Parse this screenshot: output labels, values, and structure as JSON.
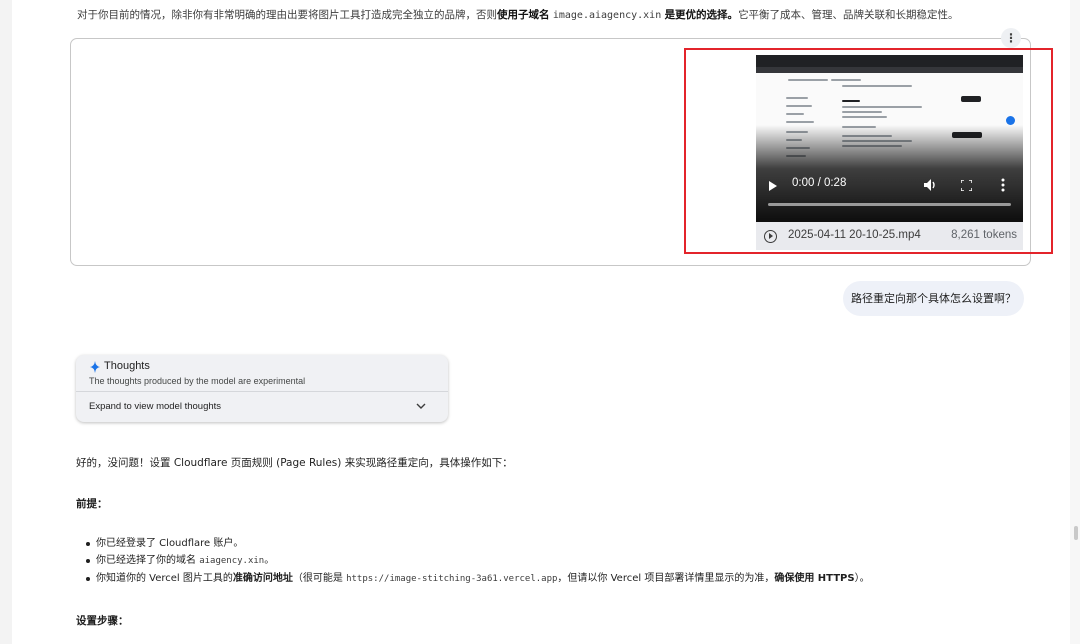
{
  "top_paragraph": {
    "prefix": "对于你目前的情况，除非你有非常明确的理由出要将图片工具打造成完全独立的品牌，否则",
    "bold_a": "使用子域名",
    "domain": "image.aiagency.xin",
    "bold_b": "是更优的选择。",
    "suffix": "它平衡了成本、管理、品牌关联和长期稳定性。"
  },
  "more_button": "⋮",
  "attachment": {
    "video_time": "0:00 / 0:28",
    "progress_fraction": 0.0,
    "file_name": "2025-04-11 20-10-25.mp4",
    "tokens": "8,261 tokens"
  },
  "user_message": "路径重定向那个具体怎么设置啊？",
  "thoughts": {
    "title": "Thoughts",
    "subtitle": "The thoughts produced by the model are experimental",
    "expand_label": "Expand to view model thoughts"
  },
  "response": {
    "intro": "好的，没问题！设置 Cloudflare 页面规则 (Page Rules) 来实现路径重定向，具体操作如下：",
    "prereq_heading": "前提：",
    "bullets": {
      "b1": "你已经登录了 Cloudflare 账户。",
      "b2_prefix": "你已经选择了你的域名 ",
      "b2_code": "aiagency.xin",
      "b2_suffix": "。",
      "b3_prefix": "你知道你的 Vercel 图片工具的",
      "b3_bold": "准确访问地址",
      "b3_mid": "（很可能是 ",
      "b3_code": "https://image-stitching-3a61.vercel.app",
      "b3_mid2": "，但请以你 Vercel 项目部署详情里显示的为准，",
      "b3_bold2": "确保使用 HTTPS",
      "b3_end": "）。"
    },
    "steps_heading": "设置步骤："
  },
  "colors": {
    "accent_blue": "#1a73e8",
    "highlight_red": "#e3242b",
    "bubble_bg": "#eef1f8",
    "thoughts_bg": "#f0f1f4"
  }
}
